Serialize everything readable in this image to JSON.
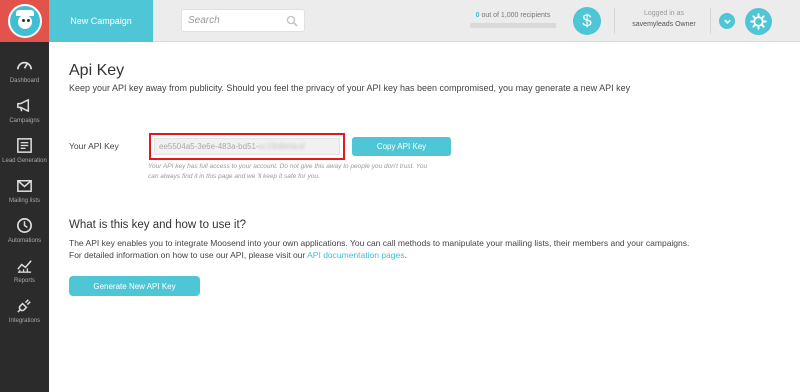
{
  "topbar": {
    "new_campaign_label": "New Campaign",
    "search_placeholder": "Search",
    "recipients_count": "0",
    "recipients_text": " out of 1,000 recipients",
    "dollar_symbol": "$",
    "logged_in_label": "Logged in as",
    "user_name": "savemyleads Owner"
  },
  "sidebar": {
    "items": [
      {
        "label": "Dashboard",
        "icon": "dashboard-icon"
      },
      {
        "label": "Campaigns",
        "icon": "megaphone-icon"
      },
      {
        "label": "Lead Generation",
        "icon": "form-icon"
      },
      {
        "label": "Mailing lists",
        "icon": "envelope-icon"
      },
      {
        "label": "Automations",
        "icon": "clock-icon"
      },
      {
        "label": "Reports",
        "icon": "chart-icon"
      },
      {
        "label": "Integrations",
        "icon": "plug-icon"
      }
    ]
  },
  "main": {
    "title": "Api Key",
    "intro": "Keep your API key away from publicity. Should you feel the privacy of your API key has been compromised, you may generate a new API key",
    "api_key_label": "Your API Key",
    "api_key_visible": "ee5504a5-3e6e-483a-bd51-",
    "api_key_blurred": "ec1fb8bfdeaf",
    "copy_button": "Copy API Key",
    "hint_line1": "Your API key has full access to your account. Do not give this away to people you don't trust. You",
    "hint_line2": "can always find it in this page and we 'll keep it safe for you.",
    "how_title": "What is this key and how to use it?",
    "how_p1": "The API key enables you to integrate Moosend into your own applications. You can call methods to manipulate your mailing lists, their members and your campaigns.",
    "how_p2_prefix": "For detailed information on how to use our API, please visit our ",
    "how_p2_link": "API documentation pages",
    "how_p2_suffix": ".",
    "generate_button": "Generate New API Key"
  },
  "colors": {
    "accent": "#4fc6d6",
    "logo_bg": "#e2534b",
    "sidebar_bg": "#2b2b2b",
    "highlight": "#e4171c"
  }
}
